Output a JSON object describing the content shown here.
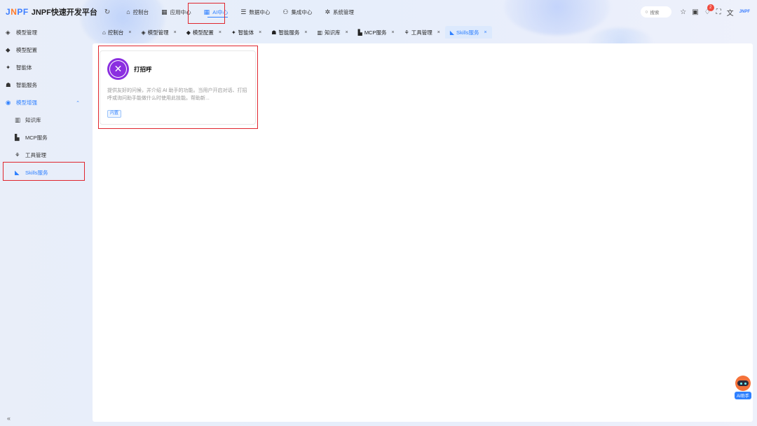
{
  "header": {
    "logo_mark": "JNPF",
    "app_title": "JNPF快速开发平台",
    "nav": [
      {
        "icon": "home-icon",
        "glyph": "⌂",
        "label": "控制台"
      },
      {
        "icon": "apps-icon",
        "glyph": "▦",
        "label": "应用中心"
      },
      {
        "icon": "ai-grid-icon",
        "glyph": "▦",
        "label": "AI中心",
        "active": true
      },
      {
        "icon": "database-icon",
        "glyph": "☰",
        "label": "数据中心"
      },
      {
        "icon": "integration-icon",
        "glyph": "⚇",
        "label": "集成中心"
      },
      {
        "icon": "settings-icon",
        "glyph": "✲",
        "label": "系统管理"
      }
    ],
    "search_placeholder": "搜索",
    "notification_count": "2",
    "brand_small": "JNPF"
  },
  "sidebar": {
    "items": [
      {
        "icon": "model-manage-icon",
        "glyph": "◈",
        "label": "模型管理"
      },
      {
        "icon": "model-config-icon",
        "glyph": "◆",
        "label": "模型配置"
      },
      {
        "icon": "agent-icon",
        "glyph": "✦",
        "label": "智能体"
      },
      {
        "icon": "robot-icon",
        "glyph": "☗",
        "label": "智能服务"
      },
      {
        "icon": "model-enhance-icon",
        "glyph": "◉",
        "label": "模型增强",
        "open": true
      },
      {
        "icon": "knowledge-icon",
        "glyph": "▥",
        "label": "知识库",
        "sub": true
      },
      {
        "icon": "mcp-icon",
        "glyph": "▙",
        "label": "MCP服务",
        "sub": true
      },
      {
        "icon": "tools-icon",
        "glyph": "⚘",
        "label": "工具管理",
        "sub": true
      },
      {
        "icon": "skills-icon",
        "glyph": "◣",
        "label": "Skills服务",
        "sub": true,
        "active": true
      }
    ],
    "collapse_glyph": "«"
  },
  "tabs": [
    {
      "icon": "home-icon",
      "glyph": "⌂",
      "label": "控制台"
    },
    {
      "icon": "model-manage-icon",
      "glyph": "◈",
      "label": "模型管理"
    },
    {
      "icon": "model-config-icon",
      "glyph": "◆",
      "label": "模型配置"
    },
    {
      "icon": "agent-icon",
      "glyph": "✦",
      "label": "智能体"
    },
    {
      "icon": "robot-icon",
      "glyph": "☗",
      "label": "智能服务"
    },
    {
      "icon": "knowledge-icon",
      "glyph": "▥",
      "label": "知识库"
    },
    {
      "icon": "mcp-icon",
      "glyph": "▙",
      "label": "MCP服务"
    },
    {
      "icon": "tools-icon",
      "glyph": "⚘",
      "label": "工具管理"
    },
    {
      "icon": "skills-icon",
      "glyph": "◣",
      "label": "Skills服务",
      "active": true
    }
  ],
  "skill_card": {
    "title": "打招呼",
    "description": "提供友好的问候，并介绍 AI 助手的功能。当用户开启对话、打招呼或询问助手能做什么时使用此技能。帮助新...",
    "tag": "内置"
  },
  "ai_assistant": {
    "label": "AI助手"
  },
  "colors": {
    "accent": "#2f80ff",
    "highlight": "#e0262e",
    "card_icon": "#8b2fe0"
  }
}
